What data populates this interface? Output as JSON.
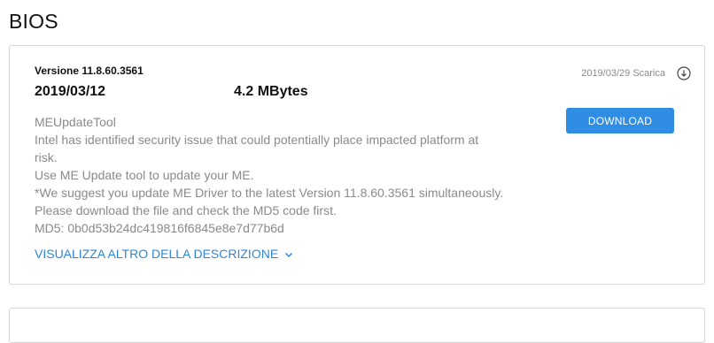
{
  "section": {
    "title": "BIOS"
  },
  "item": {
    "version": "Versione 11.8.60.3561",
    "date": "2019/03/12",
    "size": "4.2 MBytes",
    "release_text": "2019/03/29 Scarica",
    "download_label": "DOWNLOAD",
    "description_lines": [
      "MEUpdateTool",
      "Intel has identified security issue that could potentially place impacted platform at",
      "risk.",
      "Use ME Update tool to update your ME.",
      "*We suggest you update ME Driver to the latest Version 11.8.60.3561 simultaneously.",
      "Please download the file and check the MD5 code first.",
      "MD5: 0b0d53b24dc419816f6845e8e7d77b6d"
    ],
    "more_label": "VISUALIZZA ALTRO DELLA DESCRIZIONE"
  },
  "icons": {
    "download": "download-circle-icon",
    "chevron": "chevron-down-icon"
  },
  "colors": {
    "accent": "#2f8de4",
    "link": "#2b86d9",
    "muted_text": "#8a8a8a",
    "border": "#d6d6d6"
  }
}
